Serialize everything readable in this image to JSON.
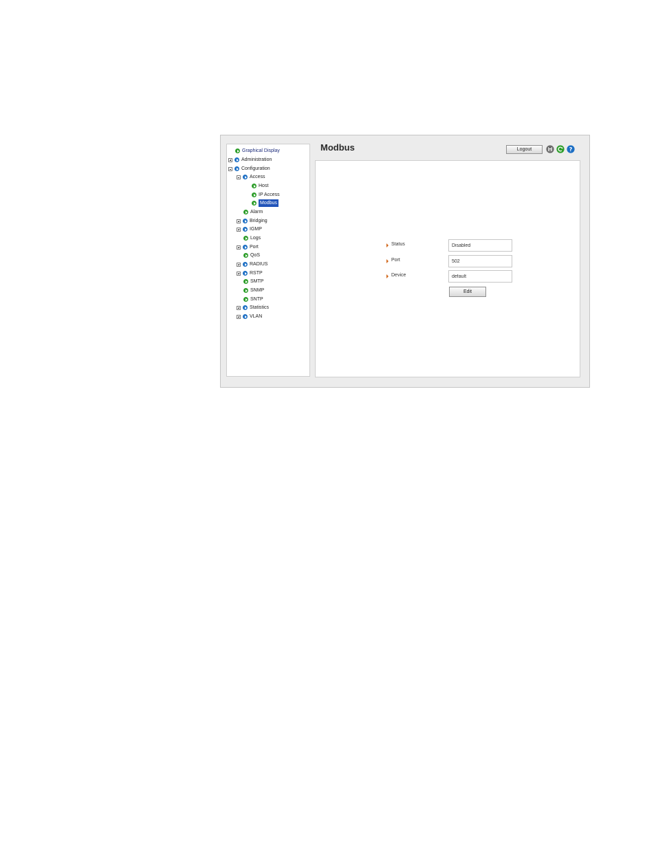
{
  "page": {
    "title": "Modbus",
    "logout_label": "Logout"
  },
  "toolbar_icons": [
    {
      "name": "save-icon",
      "color": "#6a6a6a"
    },
    {
      "name": "refresh-icon",
      "color": "#2d9d2a"
    },
    {
      "name": "help-icon",
      "color": "#1d6fc4"
    }
  ],
  "nav": {
    "items": [
      {
        "label": "Graphical Display",
        "expander": "",
        "bullet": "green",
        "link": true
      },
      {
        "label": "Administration",
        "expander": "plus",
        "bullet": "blue"
      },
      {
        "label": "Configuration",
        "expander": "minus",
        "bullet": "blue"
      },
      {
        "label": "Access",
        "expander": "minus",
        "bullet": "blue"
      },
      {
        "label": "Host",
        "expander": "",
        "bullet": "green"
      },
      {
        "label": "IP Access",
        "expander": "",
        "bullet": "green"
      },
      {
        "label": "Modbus",
        "expander": "",
        "bullet": "green",
        "selected": true
      },
      {
        "label": "Alarm",
        "expander": "",
        "bullet": "green"
      },
      {
        "label": "Bridging",
        "expander": "plus",
        "bullet": "blue"
      },
      {
        "label": "IGMP",
        "expander": "plus",
        "bullet": "blue"
      },
      {
        "label": "Logs",
        "expander": "",
        "bullet": "green"
      },
      {
        "label": "Port",
        "expander": "plus",
        "bullet": "blue"
      },
      {
        "label": "QoS",
        "expander": "",
        "bullet": "green"
      },
      {
        "label": "RADIUS",
        "expander": "plus",
        "bullet": "blue"
      },
      {
        "label": "RSTP",
        "expander": "plus",
        "bullet": "blue"
      },
      {
        "label": "SMTP",
        "expander": "",
        "bullet": "green"
      },
      {
        "label": "SNMP",
        "expander": "",
        "bullet": "green"
      },
      {
        "label": "SNTP",
        "expander": "",
        "bullet": "green"
      },
      {
        "label": "Statistics",
        "expander": "plus",
        "bullet": "blue"
      },
      {
        "label": "VLAN",
        "expander": "plus",
        "bullet": "blue"
      }
    ]
  },
  "form": {
    "fields": [
      {
        "label": "Status",
        "value": "Disabled"
      },
      {
        "label": "Port",
        "value": "502"
      },
      {
        "label": "Device",
        "value": "default"
      }
    ],
    "edit_label": "Edit"
  }
}
